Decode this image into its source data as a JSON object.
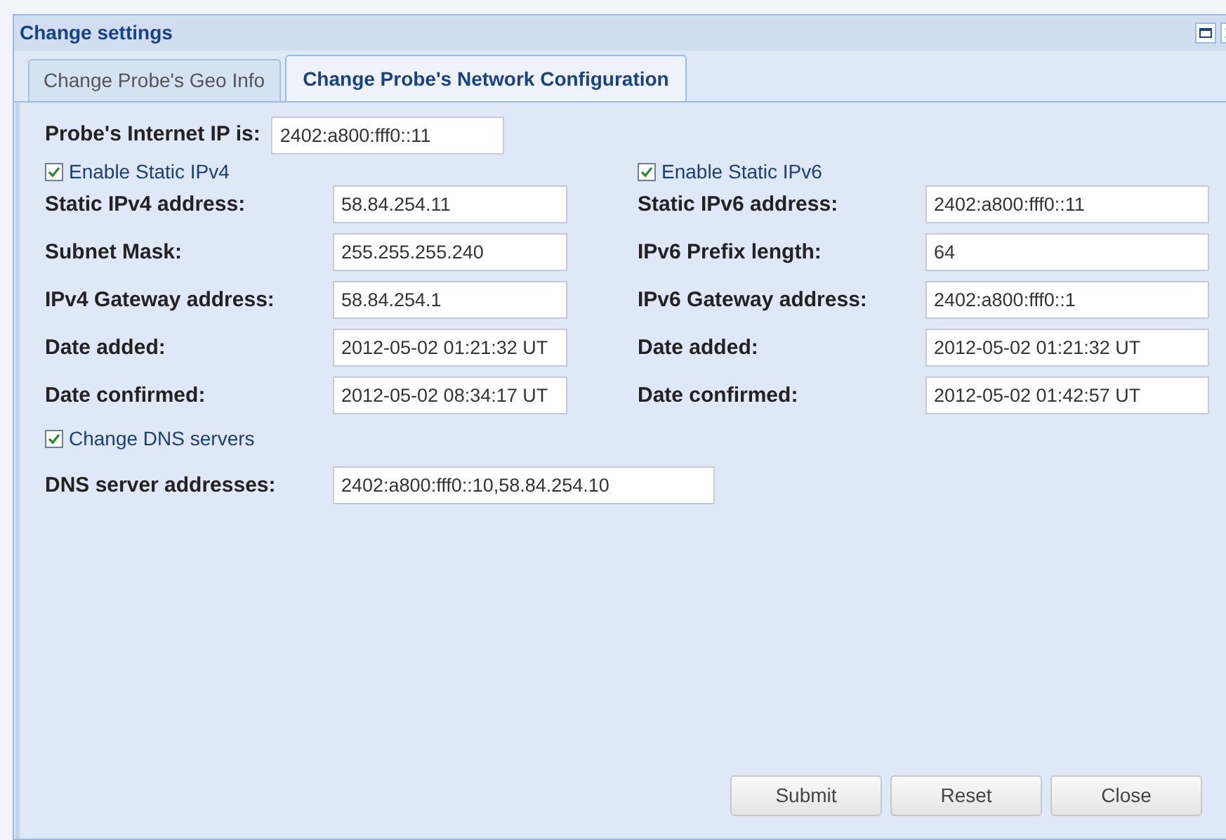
{
  "window": {
    "title": "Change settings"
  },
  "tabs": [
    {
      "label": "Change Probe's Geo Info",
      "selected": false
    },
    {
      "label": "Change Probe's Network Configuration",
      "selected": true
    }
  ],
  "internet_ip": {
    "label": "Probe's Internet IP is:",
    "value": "2402:a800:fff0::11"
  },
  "columns": [
    {
      "toggle": {
        "label": "Enable Static IPv4",
        "checked": true
      },
      "fields": [
        {
          "label": "Static IPv4 address:",
          "value": "58.84.254.11"
        },
        {
          "label": "Subnet Mask:",
          "value": "255.255.255.240"
        },
        {
          "label": "IPv4 Gateway address:",
          "value": "58.84.254.1"
        },
        {
          "label": "Date added:",
          "value": "2012-05-02 01:21:32 UT"
        },
        {
          "label": "Date confirmed:",
          "value": "2012-05-02 08:34:17 UT"
        }
      ]
    },
    {
      "toggle": {
        "label": "Enable Static IPv6",
        "checked": true
      },
      "fields": [
        {
          "label": "Static IPv6 address:",
          "value": "2402:a800:fff0::11"
        },
        {
          "label": "IPv6 Prefix length:",
          "value": "64"
        },
        {
          "label": "IPv6 Gateway address:",
          "value": "2402:a800:fff0::1"
        },
        {
          "label": "Date added:",
          "value": "2012-05-02 01:21:32 UT"
        },
        {
          "label": "Date confirmed:",
          "value": "2012-05-02 01:42:57 UT"
        }
      ]
    }
  ],
  "dns": {
    "toggle": {
      "label": "Change DNS servers",
      "checked": true
    },
    "label": "DNS server addresses:",
    "value": "2402:a800:fff0::10,58.84.254.10"
  },
  "buttons": [
    "Submit",
    "Reset",
    "Close"
  ]
}
